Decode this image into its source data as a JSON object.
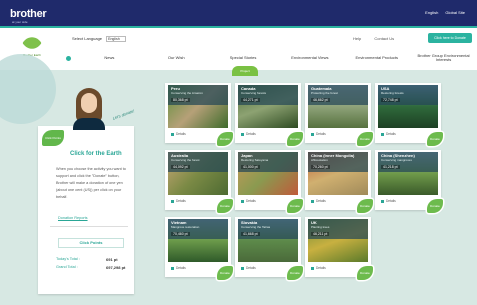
{
  "brand": {
    "logo": "brother",
    "tagline": "at your side"
  },
  "topbar": {
    "lang_en": "English",
    "lang_jp": "Global Site"
  },
  "nav": {
    "select_language_label": "Select Language",
    "select_language_value": "English",
    "help": "Help",
    "contact": "Contact Us",
    "join": "Click here to Donate",
    "earth_logo": "Brother Earth",
    "menu": [
      "News",
      "Our Wish",
      "Special Stories",
      "Environmental Views",
      "Environmental Products",
      "Brother Group Environmental Interests"
    ]
  },
  "content": {
    "tab": "Project",
    "lets": "Let's donate!",
    "click_leaf": "Click Points",
    "sidebar": {
      "title": "Click for the Earth",
      "body": "When you choose the activity you want to support and click the \"Donate\" button, Brother will make a donation of one yen (about one cent (US)) per click on your behalf.",
      "donation_link": "Donation Reports",
      "points_button": "Click Points",
      "todays_label": "Today's Total :",
      "todays_value": "691 pt",
      "grand_label": "Grand Total :",
      "grand_value": "697,298 pt"
    },
    "cards": [
      {
        "title": "Peru",
        "sub": "Conserving the Amazon",
        "points": "80,368 pt",
        "detail": "Details",
        "donate": "Donate"
      },
      {
        "title": "Canada",
        "sub": "Conserving forests",
        "points": "44,271 pt",
        "detail": "Details",
        "donate": "Donate"
      },
      {
        "title": "Guatemala",
        "sub": "Protecting the forest",
        "points": "46,662 pt",
        "detail": "Details",
        "donate": "Donate"
      },
      {
        "title": "USA",
        "sub": "Restoring forests",
        "points": "72,748 pt",
        "detail": "Details",
        "donate": "Donate"
      },
      {
        "title": "Australia",
        "sub": "Conserving the forest",
        "points": "44,092 pt",
        "detail": "Details",
        "donate": "Donate"
      },
      {
        "title": "Japan",
        "sub": "Restoring Satoyama",
        "points": "41,000 pt",
        "detail": "Details",
        "donate": "Donate"
      },
      {
        "title": "China (Inner Mongolia)",
        "sub": "Afforestation",
        "points": "70,260 pt",
        "detail": "Details",
        "donate": "Donate"
      },
      {
        "title": "China (Shenzhen)",
        "sub": "Conserving mangroves",
        "points": "41,218 pt",
        "detail": "Details",
        "donate": "Donate"
      },
      {
        "title": "Vietnam",
        "sub": "Mangrove restoration",
        "points": "70,460 pt",
        "detail": "Details",
        "donate": "Donate"
      },
      {
        "title": "Slovakia",
        "sub": "Conserving the Tatras",
        "points": "41,668 pt",
        "detail": "Details",
        "donate": "Donate"
      },
      {
        "title": "UK",
        "sub": "Planting trees",
        "points": "46,211 pt",
        "detail": "Details",
        "donate": "Donate"
      }
    ]
  },
  "colors": {
    "topbar": "#1f2a6b",
    "accent": "#2aa696",
    "leaf": "#6dbb4d"
  }
}
